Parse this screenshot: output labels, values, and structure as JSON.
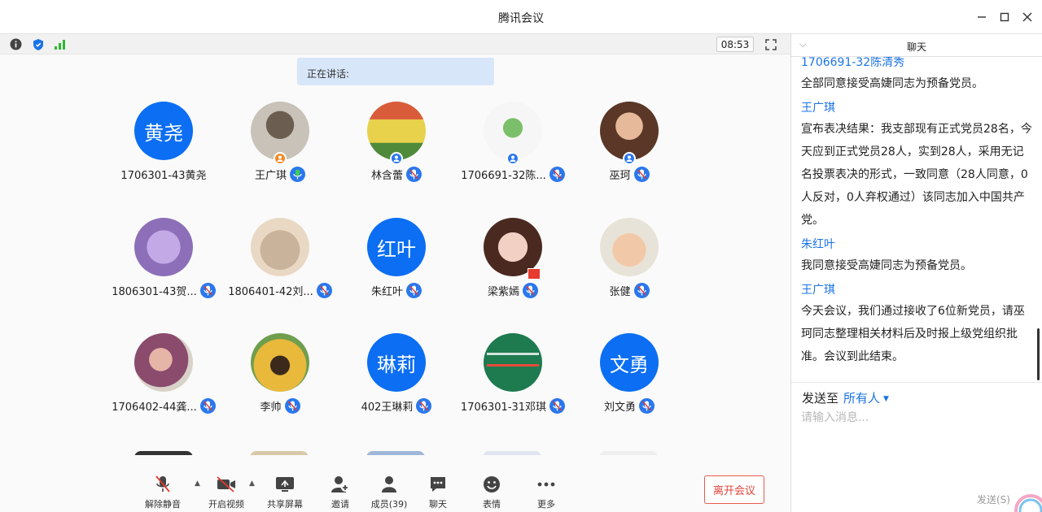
{
  "window": {
    "title": "腾讯会议"
  },
  "infobar": {
    "timer": "08:53"
  },
  "speaking": {
    "label": "正在讲话:"
  },
  "participants": [
    {
      "name": "1706301-43黄尧",
      "avatar_text": "黄尧",
      "mic": "none",
      "host": false
    },
    {
      "name": "王广琪",
      "avatar_text": "",
      "mic": "active",
      "host": true
    },
    {
      "name": "林含蕾",
      "avatar_text": "",
      "mic": "muted",
      "host": false
    },
    {
      "name": "1706691-32陈...",
      "avatar_text": "",
      "mic": "muted",
      "host": false
    },
    {
      "name": "巫珂",
      "avatar_text": "",
      "mic": "muted",
      "host": false
    },
    {
      "name": "1806301-43贺...",
      "avatar_text": "",
      "mic": "muted",
      "host": false
    },
    {
      "name": "1806401-42刘...",
      "avatar_text": "",
      "mic": "muted",
      "host": false
    },
    {
      "name": "朱红叶",
      "avatar_text": "红叶",
      "mic": "muted",
      "host": false
    },
    {
      "name": "梁紫嫣",
      "avatar_text": "",
      "mic": "muted",
      "host": false
    },
    {
      "name": "张健",
      "avatar_text": "",
      "mic": "muted",
      "host": false
    },
    {
      "name": "1706402-44龚...",
      "avatar_text": "",
      "mic": "muted",
      "host": false
    },
    {
      "name": "李帅",
      "avatar_text": "",
      "mic": "muted",
      "host": false
    },
    {
      "name": "402王琳莉",
      "avatar_text": "琳莉",
      "mic": "muted",
      "host": false
    },
    {
      "name": "1706301-31邓琪",
      "avatar_text": "",
      "mic": "muted",
      "host": false
    },
    {
      "name": "刘文勇",
      "avatar_text": "文勇",
      "mic": "muted",
      "host": false
    }
  ],
  "toolbar": {
    "unmute": "解除静音",
    "video": "开启视频",
    "share": "共享屏幕",
    "invite": "邀请",
    "members": "成员(39)",
    "chat": "聊天",
    "emoji": "表情",
    "more": "更多",
    "leave": "离开会议"
  },
  "chat": {
    "title": "聊天",
    "messages": [
      {
        "sender": "1706691-32陈清秀",
        "text": "全部同意接受高婕同志为预备党员。"
      },
      {
        "sender": "王广琪",
        "text": "宣布表决结果：我支部现有正式党员28名，今天应到正式党员28人，实到28人，采用无记名投票表决的形式，一致同意（28人同意，0人反对，0人弃权通过）该同志加入中国共产党。"
      },
      {
        "sender": "朱红叶",
        "text": "我同意接受高婕同志为预备党员。"
      },
      {
        "sender": "王广琪",
        "text": "今天会议，我们通过接收了6位新党员，请巫珂同志整理相关材料后及时报上级党组织批准。会议到此结束。"
      }
    ],
    "send_to_label": "发送至",
    "send_to_target": "所有人",
    "input_placeholder": "请输入消息...",
    "send_button": "发送(S)"
  },
  "colors": {
    "accent": "#1a73e8",
    "avatar_blue": "#0b6ef3",
    "mic_blue": "#2a77ee",
    "leave_red": "#e0443a",
    "host_orange": "#f08a24"
  }
}
